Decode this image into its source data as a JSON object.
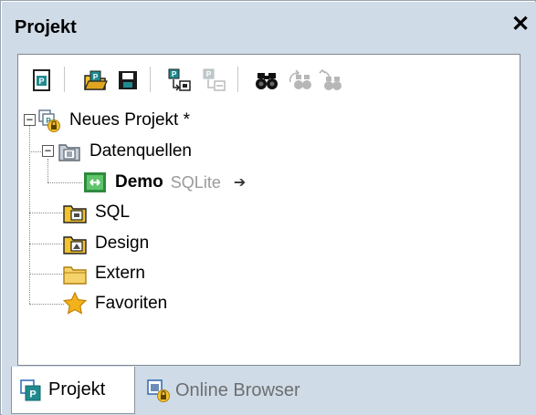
{
  "window": {
    "title": "Projekt",
    "close_symbol": "✕"
  },
  "toolbar": {
    "buttons": [
      {
        "name": "new-project-icon",
        "enabled": true
      },
      {
        "name": "open-project-icon",
        "enabled": true
      },
      {
        "name": "save-project-icon",
        "enabled": true
      },
      {
        "name": "add-to-project-icon",
        "enabled": true
      },
      {
        "name": "remove-from-project-icon",
        "enabled": false
      },
      {
        "name": "find-icon",
        "enabled": true
      },
      {
        "name": "find-next-icon",
        "enabled": false
      },
      {
        "name": "find-previous-icon",
        "enabled": false
      }
    ]
  },
  "tree": {
    "root": {
      "label": "Neues Projekt *",
      "expander": "−"
    },
    "datasources": {
      "label": "Datenquellen",
      "expander": "−"
    },
    "demo": {
      "label": "Demo",
      "sublabel": "SQLite",
      "arrow": "➔"
    },
    "items": [
      {
        "label": "SQL"
      },
      {
        "label": "Design"
      },
      {
        "label": "Extern"
      },
      {
        "label": "Favoriten"
      }
    ]
  },
  "tabs": [
    {
      "label": "Projekt",
      "active": true
    },
    {
      "label": "Online Browser",
      "active": false
    }
  ],
  "colors": {
    "chrome": "#cfdbe7",
    "accent_green": "#2e8b3d",
    "folder_yellow": "#f2c230",
    "inactive_text": "#6e6e6e"
  }
}
